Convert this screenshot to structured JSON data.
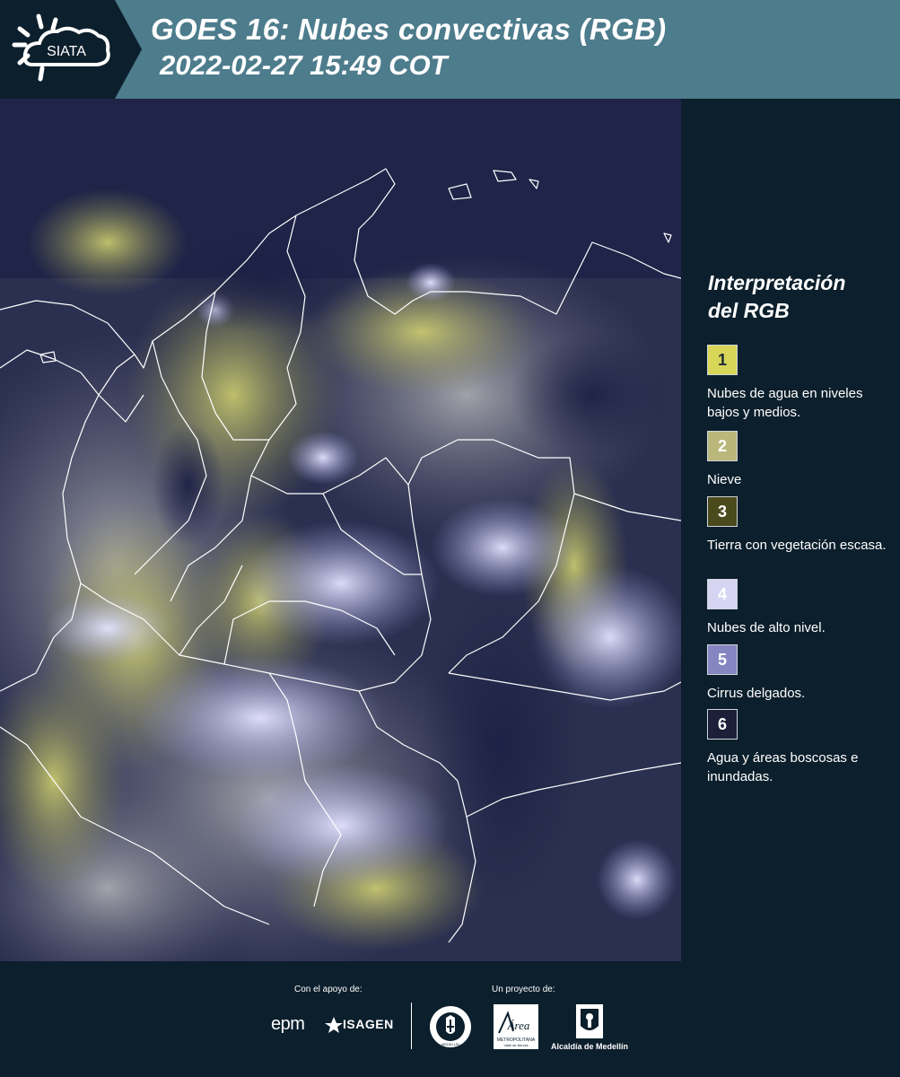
{
  "header": {
    "logo_text": "SIATA",
    "title_line1": "GOES 16: Nubes convectivas (RGB)",
    "title_line2": "2022-02-27 15:49 COT",
    "background_color": "#4d7c8c",
    "logo_background_color": "#0c1f2c"
  },
  "map": {
    "kind": "satellite-rgb-convective-clouds",
    "border_color": "#ffffff",
    "cloud_colors": {
      "low_mid_water_clouds": "#c8c86a",
      "high_clouds": "#c8c8f0",
      "clear_water_forest": "#1e2450"
    }
  },
  "legend": {
    "title_line1": "Interpretación",
    "title_line2": "del RGB",
    "items": [
      {
        "number": "1",
        "label": "Nubes de agua en niveles bajos y medios.",
        "color": "#d8d658",
        "text_color": "#1c2a35"
      },
      {
        "number": "2",
        "label": "Nieve",
        "color": "#b9b77a",
        "text_color": "#ffffff"
      },
      {
        "number": "3",
        "label": "Tierra con vegetación escasa.",
        "color": "#4b4a1c",
        "text_color": "#ffffff"
      },
      {
        "number": "4",
        "label": "Nubes de alto nivel.",
        "color": "#d5d5f2",
        "text_color": "#ffffff"
      },
      {
        "number": "5",
        "label": "Cirrus delgados.",
        "color": "#8585c2",
        "text_color": "#ffffff"
      },
      {
        "number": "6",
        "label": "Agua y áreas boscosas e inundadas.",
        "color": "#1b1f38",
        "text_color": "#ffffff"
      }
    ]
  },
  "footer": {
    "support_label": "Con el apoyo de:",
    "project_label": "Un proyecto de:",
    "sponsor_epm": "epm",
    "sponsor_isagen": "ISAGEN",
    "area_logo_text": "Área",
    "area_logo_subtext": "METROPOLITANA",
    "area_logo_subtext2": "Valle de Aburrá",
    "alcaldia_text": "Alcaldía de Medellín",
    "seal_text": "MEDELLÍN"
  }
}
